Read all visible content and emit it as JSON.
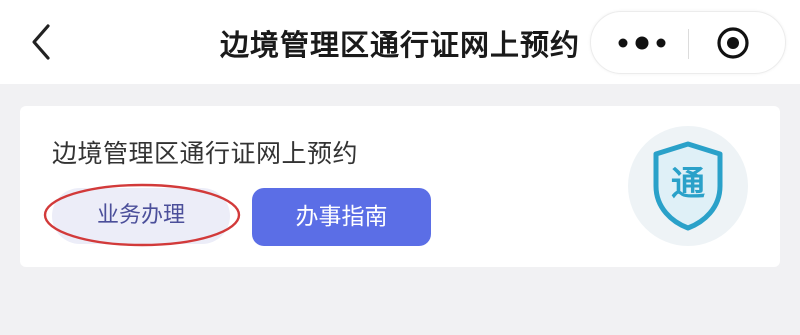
{
  "header": {
    "title": "边境管理区通行证网上预约"
  },
  "card": {
    "title": "边境管理区通行证网上预约",
    "business_button": "业务办理",
    "guide_button": "办事指南",
    "badge_char": "通"
  },
  "colors": {
    "accent": "#5b6ee6",
    "badge": "#2aa1c9",
    "highlight_ring": "#d23a3a",
    "background": "#f1f1f3"
  },
  "icons": {
    "back": "chevron-left-icon",
    "more": "more-dots-icon",
    "close": "target-close-icon",
    "badge": "shield-icon"
  }
}
